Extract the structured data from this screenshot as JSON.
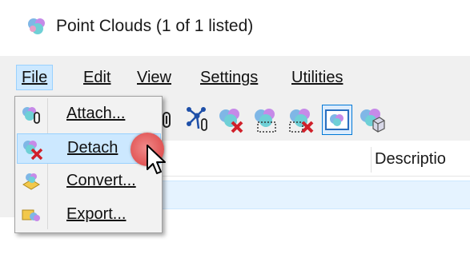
{
  "window": {
    "title": "Point Clouds (1 of 1 listed)",
    "icon": "point-cloud-icon"
  },
  "menubar": {
    "items": [
      {
        "label": "File",
        "active": true
      },
      {
        "label": "Edit",
        "active": false
      },
      {
        "label": "View",
        "active": false
      },
      {
        "label": "Settings",
        "active": false
      },
      {
        "label": "Utilities",
        "active": false
      }
    ]
  },
  "file_menu": {
    "items": [
      {
        "label": "Attach...",
        "icon": "attach-cloud-icon",
        "highlighted": false
      },
      {
        "label": "Detach",
        "icon": "detach-cloud-icon",
        "highlighted": true
      },
      {
        "label": "Convert...",
        "icon": "convert-icon",
        "highlighted": false
      },
      {
        "label": "Export...",
        "icon": "export-icon",
        "highlighted": false
      }
    ]
  },
  "toolbar": {
    "tools": [
      "attach-paperclip-icon",
      "attach-tree-icon",
      "detach-cloud-icon",
      "cloud-dotted-icon",
      "detach-cloud-dotted-icon",
      "display-cloud-icon",
      "cloud-cube-icon"
    ]
  },
  "list": {
    "columns": [
      {
        "label": "Descriptio"
      }
    ]
  },
  "colors": {
    "menu_highlight": "#cce8ff",
    "row_selected": "#e5f3ff",
    "click_marker": "#e35b5b"
  }
}
